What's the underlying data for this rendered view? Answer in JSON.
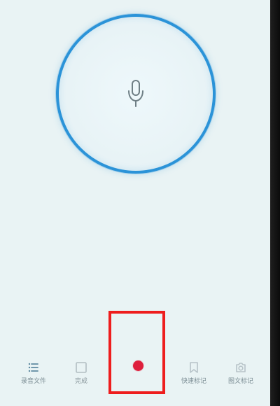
{
  "screen": {
    "background": "#e9f3f4",
    "accent": "#2b93d8",
    "record_color": "#de1f3c",
    "highlight_color": "#ee1d1d"
  },
  "record_area": {
    "icon": "microphone-icon"
  },
  "toolbar": {
    "files_label": "录音文件",
    "finish_label": "完成",
    "quick_mark_label": "快速标记",
    "image_mark_label": "图文标记"
  },
  "icons": {
    "files": "list-icon",
    "finish": "square-icon",
    "record": "record-dot-icon",
    "quick_mark": "bookmark-icon",
    "image_mark": "camera-icon"
  }
}
